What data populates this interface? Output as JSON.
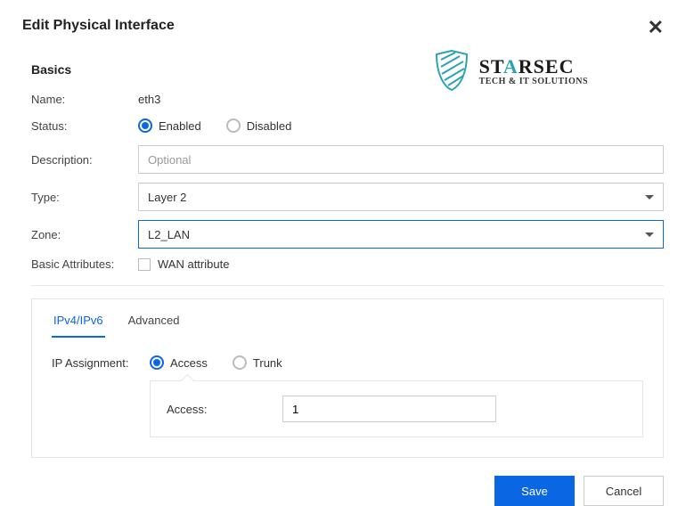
{
  "title": "Edit Physical Interface",
  "logo": {
    "main_pre": "ST",
    "main_tri": "A",
    "main_post": "RSEC",
    "sub": "TECH & IT SOLUTIONS"
  },
  "basics": {
    "section": "Basics",
    "name_label": "Name:",
    "name_value": "eth3",
    "status_label": "Status:",
    "status_enabled": "Enabled",
    "status_disabled": "Disabled",
    "description_label": "Description:",
    "description_placeholder": "Optional",
    "type_label": "Type:",
    "type_value": "Layer 2",
    "zone_label": "Zone:",
    "zone_value": "L2_LAN",
    "basic_attr_label": "Basic Attributes:",
    "wan_attr": "WAN attribute"
  },
  "tabs": {
    "ipv": "IPv4/IPv6",
    "advanced": "Advanced"
  },
  "ip": {
    "assignment_label": "IP Assignment:",
    "access": "Access",
    "trunk": "Trunk",
    "access_field_label": "Access:",
    "access_value": "1"
  },
  "buttons": {
    "save": "Save",
    "cancel": "Cancel"
  }
}
